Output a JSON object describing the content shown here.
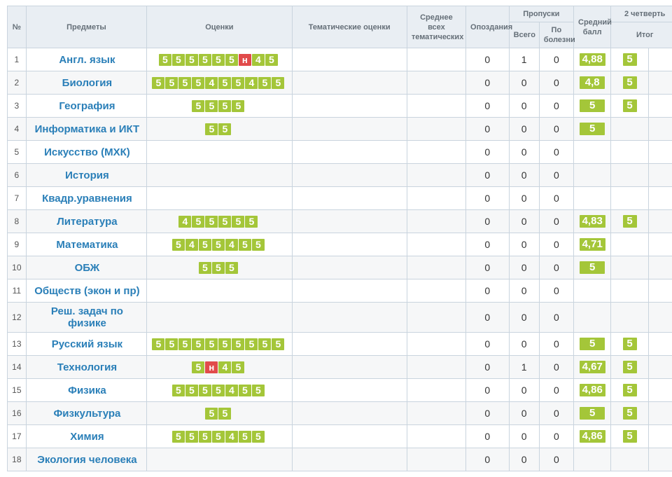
{
  "headers": {
    "num": "№",
    "subject": "Предметы",
    "grades": "Оценки",
    "thematic": "Тематические оценки",
    "avg_thematic": "Среднее всех тематических",
    "lates": "Опоздания",
    "absences": "Пропуски",
    "abs_total": "Всего",
    "abs_ill": "По болезни",
    "avg": "Средний балл",
    "quarter": "2 четверть",
    "itog": "Итог"
  },
  "rows": [
    {
      "n": "1",
      "subject": "Англ. язык",
      "grades": [
        "5",
        "5",
        "5",
        "5",
        "5",
        "5",
        "н",
        "4",
        "5"
      ],
      "late": "0",
      "abs_t": "1",
      "abs_i": "0",
      "avg": "4,88",
      "q": "5"
    },
    {
      "n": "2",
      "subject": "Биология",
      "grades": [
        "5",
        "5",
        "5",
        "5",
        "4",
        "5",
        "5",
        "4",
        "5",
        "5"
      ],
      "late": "0",
      "abs_t": "0",
      "abs_i": "0",
      "avg": "4,8",
      "q": "5"
    },
    {
      "n": "3",
      "subject": "География",
      "grades": [
        "5",
        "5",
        "5",
        "5"
      ],
      "late": "0",
      "abs_t": "0",
      "abs_i": "0",
      "avg": "5",
      "q": "5"
    },
    {
      "n": "4",
      "subject": "Информатика и ИКТ",
      "grades": [
        "5",
        "5"
      ],
      "late": "0",
      "abs_t": "0",
      "abs_i": "0",
      "avg": "5",
      "q": ""
    },
    {
      "n": "5",
      "subject": "Искусство (МХК)",
      "grades": [],
      "late": "0",
      "abs_t": "0",
      "abs_i": "0",
      "avg": "",
      "q": ""
    },
    {
      "n": "6",
      "subject": "История",
      "grades": [],
      "late": "0",
      "abs_t": "0",
      "abs_i": "0",
      "avg": "",
      "q": ""
    },
    {
      "n": "7",
      "subject": "Квадр.уравнения",
      "grades": [],
      "late": "0",
      "abs_t": "0",
      "abs_i": "0",
      "avg": "",
      "q": ""
    },
    {
      "n": "8",
      "subject": "Литература",
      "grades": [
        "4",
        "5",
        "5",
        "5",
        "5",
        "5"
      ],
      "late": "0",
      "abs_t": "0",
      "abs_i": "0",
      "avg": "4,83",
      "q": "5"
    },
    {
      "n": "9",
      "subject": "Математика",
      "grades": [
        "5",
        "4",
        "5",
        "5",
        "4",
        "5",
        "5"
      ],
      "late": "0",
      "abs_t": "0",
      "abs_i": "0",
      "avg": "4,71",
      "q": ""
    },
    {
      "n": "10",
      "subject": "ОБЖ",
      "grades": [
        "5",
        "5",
        "5"
      ],
      "late": "0",
      "abs_t": "0",
      "abs_i": "0",
      "avg": "5",
      "q": ""
    },
    {
      "n": "11",
      "subject": "Обществ (экон и пр)",
      "grades": [],
      "late": "0",
      "abs_t": "0",
      "abs_i": "0",
      "avg": "",
      "q": ""
    },
    {
      "n": "12",
      "subject": "Реш. задач по физике",
      "grades": [],
      "late": "0",
      "abs_t": "0",
      "abs_i": "0",
      "avg": "",
      "q": ""
    },
    {
      "n": "13",
      "subject": "Русский язык",
      "grades": [
        "5",
        "5",
        "5",
        "5",
        "5",
        "5",
        "5",
        "5",
        "5",
        "5"
      ],
      "late": "0",
      "abs_t": "0",
      "abs_i": "0",
      "avg": "5",
      "q": "5"
    },
    {
      "n": "14",
      "subject": "Технология",
      "grades": [
        "5",
        "н",
        "4",
        "5"
      ],
      "late": "0",
      "abs_t": "1",
      "abs_i": "0",
      "avg": "4,67",
      "q": "5"
    },
    {
      "n": "15",
      "subject": "Физика",
      "grades": [
        "5",
        "5",
        "5",
        "5",
        "4",
        "5",
        "5"
      ],
      "late": "0",
      "abs_t": "0",
      "abs_i": "0",
      "avg": "4,86",
      "q": "5"
    },
    {
      "n": "16",
      "subject": "Физкультура",
      "grades": [
        "5",
        "5"
      ],
      "late": "0",
      "abs_t": "0",
      "abs_i": "0",
      "avg": "5",
      "q": "5"
    },
    {
      "n": "17",
      "subject": "Химия",
      "grades": [
        "5",
        "5",
        "5",
        "5",
        "4",
        "5",
        "5"
      ],
      "late": "0",
      "abs_t": "0",
      "abs_i": "0",
      "avg": "4,86",
      "q": "5"
    },
    {
      "n": "18",
      "subject": "Экология человека",
      "grades": [],
      "late": "0",
      "abs_t": "0",
      "abs_i": "0",
      "avg": "",
      "q": ""
    }
  ]
}
